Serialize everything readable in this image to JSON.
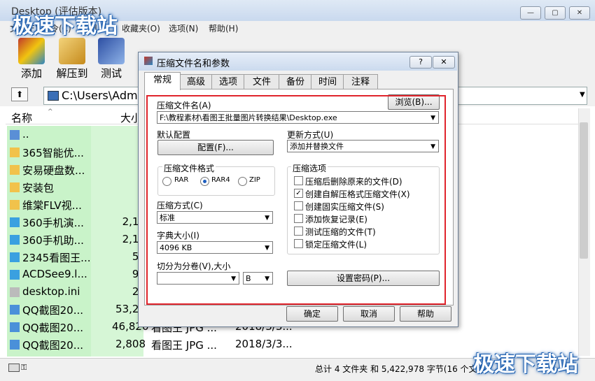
{
  "window": {
    "title": "Desktop (评估版本)",
    "min": "—",
    "max": "▢",
    "close": "✕"
  },
  "menu": [
    "文件(F)",
    "命令(C)",
    "工具(S)",
    "收藏夹(O)",
    "选项(N)",
    "帮助(H)"
  ],
  "toolbar": [
    {
      "label": "添加",
      "icon": "add-archive-icon"
    },
    {
      "label": "解压到",
      "icon": "extract-icon"
    },
    {
      "label": "测试",
      "icon": "test-icon"
    }
  ],
  "address": {
    "up": "⬆",
    "path": "C:\\Users\\Admi"
  },
  "list": {
    "headers": {
      "name": "名称",
      "size": "大小"
    },
    "rows": [
      {
        "name": "..",
        "size": "",
        "type": "",
        "date": "",
        "icon": "drive-icon"
      },
      {
        "name": "365智能优...",
        "size": "",
        "type": "",
        "date": "",
        "icon": "folder-icon"
      },
      {
        "name": "安易硬盘数...",
        "size": "",
        "type": "",
        "date": "",
        "icon": "folder-icon"
      },
      {
        "name": "安装包",
        "size": "",
        "type": "",
        "date": "",
        "icon": "folder-icon"
      },
      {
        "name": "维棠FLV视...",
        "size": "",
        "type": "",
        "date": "",
        "icon": "folder-icon"
      },
      {
        "name": "360手机演...",
        "size": "2,14",
        "type": "",
        "date": "",
        "icon": "app-icon"
      },
      {
        "name": "360手机助...",
        "size": "2,14",
        "type": "",
        "date": "",
        "icon": "app-icon"
      },
      {
        "name": "2345看图王...",
        "size": "58",
        "type": "",
        "date": "",
        "icon": "app-icon"
      },
      {
        "name": "ACDSee9.l...",
        "size": "99",
        "type": "",
        "date": "",
        "icon": "app-icon"
      },
      {
        "name": "desktop.ini",
        "size": "28",
        "type": "",
        "date": "",
        "icon": "file-icon"
      },
      {
        "name": "QQ截图20...",
        "size": "53,21",
        "type": "",
        "date": "",
        "icon": "image-icon"
      },
      {
        "name": "QQ截图20...",
        "size": "46,820",
        "type": "看图王 JPG ...",
        "date": "2018/3/3...",
        "icon": "image-icon"
      },
      {
        "name": "QQ截图20...",
        "size": "2,808",
        "type": "看图王 JPG ...",
        "date": "2018/3/3...",
        "icon": "image-icon"
      }
    ]
  },
  "status": {
    "text": "总计 4 文件夹 和 5,422,978 字节(16 个文件)"
  },
  "watermark": "极速下载站",
  "dialog": {
    "title": "压缩文件名和参数",
    "help": "?",
    "close": "✕",
    "tabs": [
      "常规",
      "高级",
      "选项",
      "文件",
      "备份",
      "时间",
      "注释"
    ],
    "browse": "浏览(B)...",
    "archive_name_label": "压缩文件名(A)",
    "archive_name": "F:\\教程素材\\看图王批量图片转换结果\\Desktop.exe",
    "default_config_label": "默认配置",
    "config_button": "配置(F)...",
    "update_mode_label": "更新方式(U)",
    "update_mode": "添加并替换文件",
    "format_label": "压缩文件格式",
    "formats": [
      "RAR",
      "RAR4",
      "ZIP"
    ],
    "format_selected": "RAR4",
    "method_label": "压缩方式(C)",
    "method": "标准",
    "dict_label": "字典大小(I)",
    "dict": "4096 KB",
    "split_label": "切分为分卷(V),大小",
    "split_value": "",
    "split_unit": "B",
    "options_label": "压缩选项",
    "options": [
      {
        "label": "压缩后删除原来的文件(D)",
        "checked": false
      },
      {
        "label": "创建自解压格式压缩文件(X)",
        "checked": true
      },
      {
        "label": "创建固实压缩文件(S)",
        "checked": false
      },
      {
        "label": "添加恢复记录(E)",
        "checked": false
      },
      {
        "label": "测试压缩的文件(T)",
        "checked": false
      },
      {
        "label": "锁定压缩文件(L)",
        "checked": false
      }
    ],
    "set_password": "设置密码(P)...",
    "ok": "确定",
    "cancel": "取消",
    "help_button": "帮助",
    "check_mark": "✓"
  }
}
